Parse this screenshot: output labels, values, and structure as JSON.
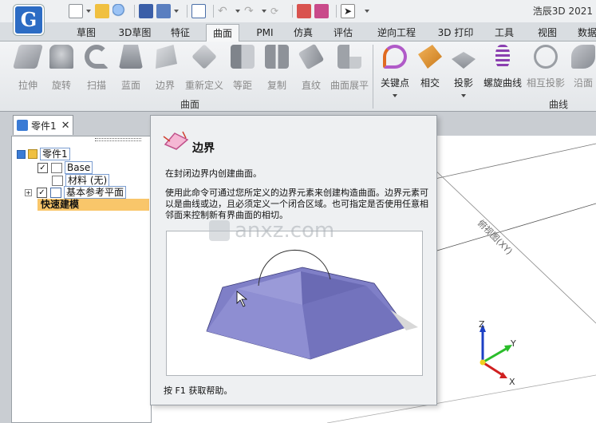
{
  "window": {
    "title": "浩辰3D 2021"
  },
  "app": {
    "logo_letter": "G"
  },
  "menu_tabs": [
    {
      "label": "草图"
    },
    {
      "label": "3D草图"
    },
    {
      "label": "特征"
    },
    {
      "label": "曲面"
    },
    {
      "label": "PMI"
    },
    {
      "label": "仿真"
    },
    {
      "label": "评估"
    },
    {
      "label": "逆向工程"
    },
    {
      "label": "3D 打印"
    },
    {
      "label": "工具"
    },
    {
      "label": "视图"
    },
    {
      "label": "数据"
    }
  ],
  "ribbon": {
    "surface_group": {
      "label": "曲面",
      "buttons": [
        {
          "label": "拉伸"
        },
        {
          "label": "旋转"
        },
        {
          "label": "扫描"
        },
        {
          "label": "蓝面"
        },
        {
          "label": "边界"
        },
        {
          "label": "重新定义"
        },
        {
          "label": "等距"
        },
        {
          "label": "复制"
        },
        {
          "label": "直纹"
        },
        {
          "label": "曲面展平"
        }
      ]
    },
    "curve_group": {
      "label": "曲线",
      "buttons": [
        {
          "label": "关键点"
        },
        {
          "label": "相交"
        },
        {
          "label": "投影"
        },
        {
          "label": "螺旋曲线"
        },
        {
          "label": "相互投影"
        },
        {
          "label": "沿面"
        }
      ]
    }
  },
  "doc_tab": {
    "label": "零件1",
    "close": "✕"
  },
  "tree": {
    "root": "零件1",
    "base": "Base",
    "material": "材料 (无)",
    "ref_planes": "基本参考平面",
    "quick_build": "快速建模",
    "checkmark": "✓",
    "expand": "+"
  },
  "viewport": {
    "plane_label": "俯视图(XY)",
    "axis_x": "X",
    "axis_y": "Y",
    "axis_z": "Z"
  },
  "tooltip": {
    "title": "边界",
    "summary": "在封闭边界内创建曲面。",
    "description": "使用此命令可通过您所定义的边界元素来创建构造曲面。边界元素可以是曲线或边，且必须定义一个闭合区域。也可指定是否使用任意相邻面来控制新有界曲面的相切。",
    "help": "按 F1 获取帮助。"
  },
  "watermark": {
    "text": "anxz.com"
  },
  "colors": {
    "accent": "#2c6cc4",
    "quick_build_highlight": "#f9c66a",
    "figure_solid": "#7f7fc7",
    "figure_solid_dark": "#6a6ab4"
  }
}
